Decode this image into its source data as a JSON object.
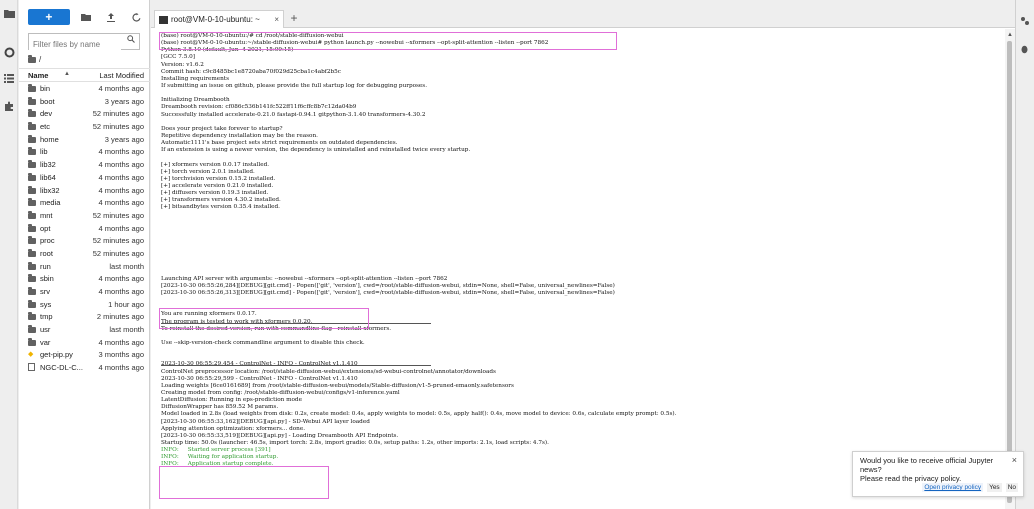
{
  "filebrowser": {
    "new_label": "+",
    "filter_placeholder": "Filter files by name",
    "breadcrumb": "/",
    "col_name": "Name",
    "col_sort": "▲",
    "col_modified": "Last Modified",
    "rows": [
      {
        "name": "bin",
        "modified": "4 months ago",
        "type": "folder"
      },
      {
        "name": "boot",
        "modified": "3 years ago",
        "type": "folder"
      },
      {
        "name": "dev",
        "modified": "52 minutes ago",
        "type": "folder"
      },
      {
        "name": "etc",
        "modified": "52 minutes ago",
        "type": "folder"
      },
      {
        "name": "home",
        "modified": "3 years ago",
        "type": "folder"
      },
      {
        "name": "lib",
        "modified": "4 months ago",
        "type": "folder"
      },
      {
        "name": "lib32",
        "modified": "4 months ago",
        "type": "folder"
      },
      {
        "name": "lib64",
        "modified": "4 months ago",
        "type": "folder"
      },
      {
        "name": "libx32",
        "modified": "4 months ago",
        "type": "folder"
      },
      {
        "name": "media",
        "modified": "4 months ago",
        "type": "folder"
      },
      {
        "name": "mnt",
        "modified": "52 minutes ago",
        "type": "folder"
      },
      {
        "name": "opt",
        "modified": "4 months ago",
        "type": "folder"
      },
      {
        "name": "proc",
        "modified": "52 minutes ago",
        "type": "folder"
      },
      {
        "name": "root",
        "modified": "52 minutes ago",
        "type": "folder"
      },
      {
        "name": "run",
        "modified": "last month",
        "type": "folder"
      },
      {
        "name": "sbin",
        "modified": "4 months ago",
        "type": "folder"
      },
      {
        "name": "srv",
        "modified": "4 months ago",
        "type": "folder"
      },
      {
        "name": "sys",
        "modified": "1 hour ago",
        "type": "folder"
      },
      {
        "name": "tmp",
        "modified": "2 minutes ago",
        "type": "folder"
      },
      {
        "name": "usr",
        "modified": "last month",
        "type": "folder"
      },
      {
        "name": "var",
        "modified": "4 months ago",
        "type": "folder"
      },
      {
        "name": "get-pip.py",
        "modified": "3 months ago",
        "type": "python"
      },
      {
        "name": "NGC-DL-C...",
        "modified": "4 months ago",
        "type": "file"
      }
    ]
  },
  "tab": {
    "title": "root@VM-0-10-ubuntu: ~",
    "close": "×",
    "add": "+"
  },
  "terminal": {
    "lines": [
      "(base) root@VM-0-10-ubuntu:/# cd /root/stable-diffusion-webui",
      "(base) root@VM-0-10-ubuntu:~/stable-diffusion-webui# python launch.py --nowebui --xformers --opt-split-attention --listen --port 7862",
      "Python 3.8.10 (default, Jun  4 2021, 15:09:15)",
      "[GCC 7.5.0]",
      "Version: v1.6.2",
      "Commit hash: c9c8485bc1e8720aba70f029d25cba1c4abf2b5c",
      "Installing requirements",
      "If submitting an issue on github, please provide the full startup log for debugging purposes.",
      "",
      "Initializing Dreambooth",
      "Dreambooth revision: cf086c536b141fc522ff11f6cffc8b7c12da04b9",
      "Successfully installed accelerate-0.21.0 fastapi-0.94.1 gitpython-3.1.40 transformers-4.30.2",
      "",
      "Does your project take forever to startup?",
      "Repetitive dependency installation may be the reason.",
      "Automatic1111's base project sets strict requirements on outdated dependencies.",
      "If an extension is using a newer version, the dependency is uninstalled and reinstalled twice every startup.",
      "",
      "[+] xformers version 0.0.17 installed.",
      "[+] torch version 2.0.1 installed.",
      "[+] torchvision version 0.15.2 installed.",
      "[+] accelerate version 0.21.0 installed.",
      "[+] diffusers version 0.19.3 installed.",
      "[+] transformers version 4.30.2 installed.",
      "[+] bitsandbytes version 0.35.4 installed.",
      "",
      "",
      "",
      "",
      "",
      "",
      "",
      "",
      "",
      "Launching API server with arguments: --nowebui --xformers --opt-split-attention --listen --port 7862",
      "[2023-10-30 06:55:26,284][DEBUG][git.cmd] - Popen(['git', 'version'], cwd=/root/stable-diffusion-webui, stdin=None, shell=False, universal_newlines=False)",
      "[2023-10-30 06:55:26,313][DEBUG][git.cmd] - Popen(['git', 'version'], cwd=/root/stable-diffusion-webui, stdin=None, shell=False, universal_newlines=False)",
      "",
      "",
      "You are running xformers 0.0.17.",
      "The program is tested to work with xformers 0.0.20.",
      "To reinstall the desired version, run with commandline flag --reinstall-xformers.",
      "",
      "Use --skip-version-check commandline argument to disable this check.",
      "",
      "",
      "2023-10-30 06:55:29,454 - ControlNet - INFO - ControlNet v1.1.410",
      "ControlNet preprocessor location: /root/stable-diffusion-webui/extensions/sd-webui-controlnet/annotator/downloads",
      "2023-10-30 06:55:29,599 - ControlNet - INFO - ControlNet v1.1.410",
      "Loading weights [6ce0161689] from /root/stable-diffusion-webui/models/Stable-diffusion/v1-5-pruned-emaonly.safetensors",
      "Creating model from config: /root/stable-diffusion-webui/configs/v1-inference.yaml",
      "LatentDiffusion: Running in eps-prediction mode",
      "DiffusionWrapper has 859.52 M params.",
      "Model loaded in 2.8s (load weights from disk: 0.2s, create model: 0.4s, apply weights to model: 0.5s, apply half(): 0.4s, move model to device: 0.6s, calculate empty prompt: 0.5s).",
      "[2023-10-30 06:55:33,162][DEBUG][api.py] - SD-Webui API layer loaded",
      "Applying attention optimization: xformers... done.",
      "[2023-10-30 06:55:33,519][DEBUG][api.py] - Loading Dreambooth API Endpoints.",
      "Startup time: 50.0s (launcher: 46.5s, import torch: 2.8s, import gradio: 0.0s, setup paths: 1.2s, other imports: 2.1s, load scripts: 4.7s).",
      "INFO:     Started server process [391]",
      "INFO:     Waiting for application startup.",
      "INFO:     Application startup complete."
    ]
  },
  "toast": {
    "message": "Would you like to receive official Jupyter news?",
    "sub": "Please read the privacy policy.",
    "close": "×",
    "link": "Open privacy policy",
    "yes": "Yes",
    "no": "No"
  }
}
